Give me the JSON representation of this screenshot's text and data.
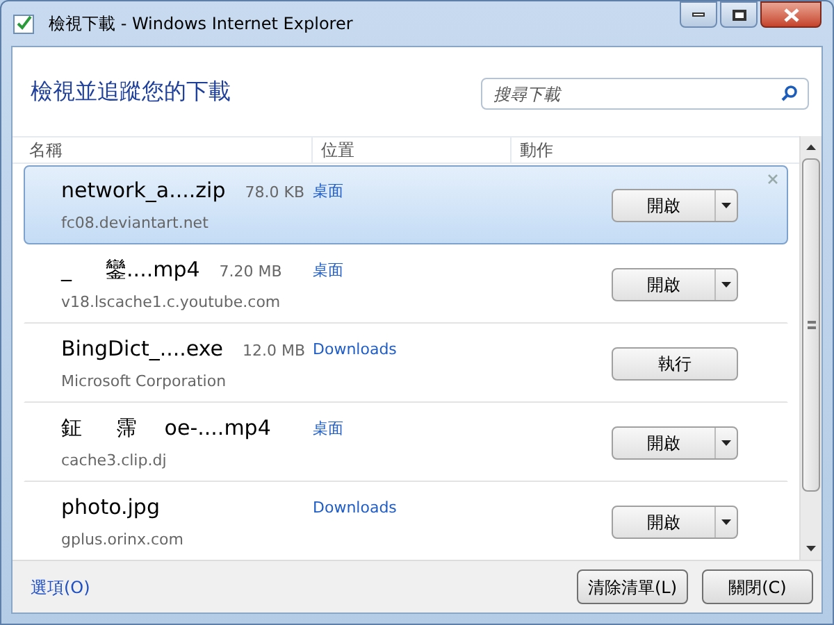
{
  "window": {
    "title": "檢視下載 - Windows Internet Explorer"
  },
  "heading": "檢視並追蹤您的下載",
  "search": {
    "placeholder": "搜尋下載"
  },
  "columns": [
    "名稱",
    "位置",
    "動作"
  ],
  "downloads": [
    {
      "name": "network_a....zip",
      "size": "78.0 KB",
      "source": "fc08.deviantart.net",
      "location": "桌面",
      "action": {
        "kind": "split",
        "label": "開啟"
      },
      "selected": true
    },
    {
      "name": "_ 　 鑾....mp4",
      "size": "7.20 MB",
      "source": "v18.lscache1.c.youtube.com",
      "location": "桌面",
      "action": {
        "kind": "split",
        "label": "開啟"
      },
      "selected": false
    },
    {
      "name": "BingDict_....exe",
      "size": "12.0 MB",
      "source": "Microsoft Corporation",
      "location": "Downloads",
      "action": {
        "kind": "plain",
        "label": "執行"
      },
      "selected": false
    },
    {
      "name": "鉦 　 霈 　oe-....mp4",
      "source": "cache3.clip.dj",
      "location": "桌面",
      "action": {
        "kind": "split",
        "label": "開啟"
      },
      "selected": false
    },
    {
      "name": "photo.jpg",
      "source": "gplus.orinx.com",
      "location": "Downloads",
      "action": {
        "kind": "split",
        "label": "開啟"
      },
      "selected": false
    }
  ],
  "footer": {
    "options_link": "選項(O)",
    "buttons": [
      "清除清單(L)",
      "關閉(C)"
    ]
  }
}
